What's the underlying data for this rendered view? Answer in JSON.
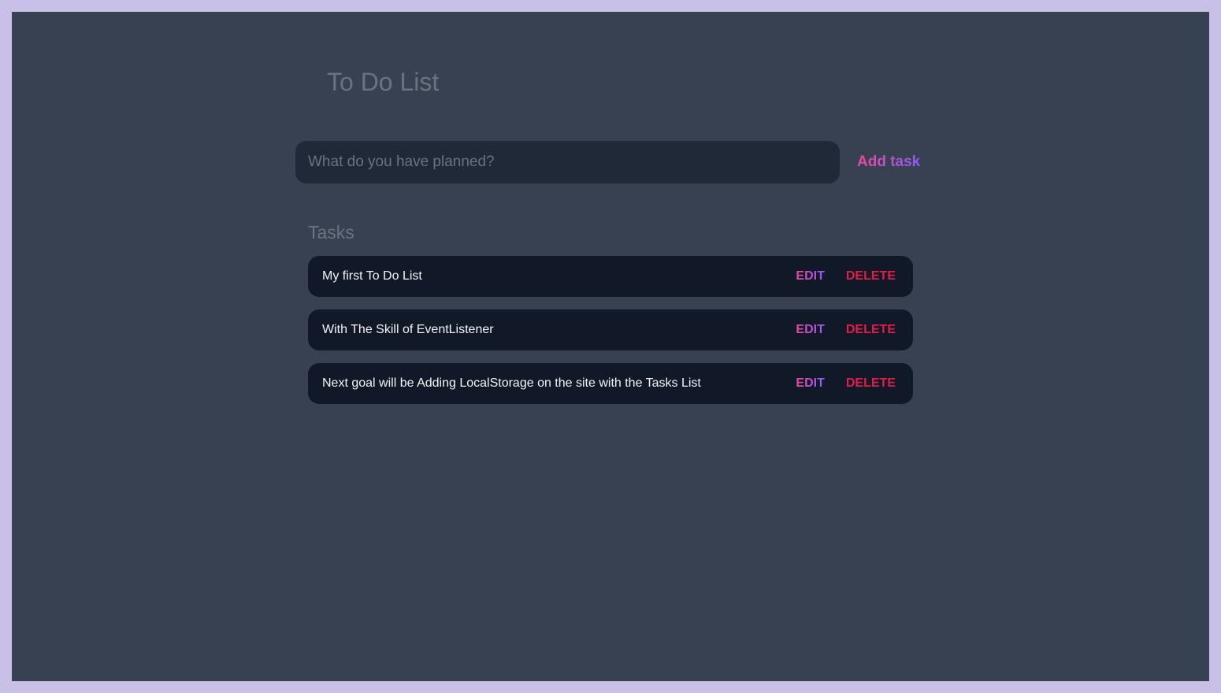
{
  "header": {
    "title": "To Do List"
  },
  "form": {
    "placeholder": "What do you have planned?",
    "value": "",
    "add_label": "Add task"
  },
  "tasks_section": {
    "heading": "Tasks",
    "items": [
      {
        "text": "My first To Do List",
        "edit_label": "EDIT",
        "delete_label": "DELETE"
      },
      {
        "text": "With The Skill of EventListener",
        "edit_label": "EDIT",
        "delete_label": "DELETE"
      },
      {
        "text": "Next goal will be Adding LocalStorage on the site with the Tasks List",
        "edit_label": "EDIT",
        "delete_label": "DELETE"
      }
    ]
  },
  "colors": {
    "page_border": "#c8c0e6",
    "app_background": "#374151",
    "input_background": "#1f2937",
    "task_background": "#111827",
    "muted_text": "#6b7280",
    "accent_gradient_start": "#ec4899",
    "accent_gradient_end": "#8b5cf6",
    "delete": "#e11d48"
  }
}
